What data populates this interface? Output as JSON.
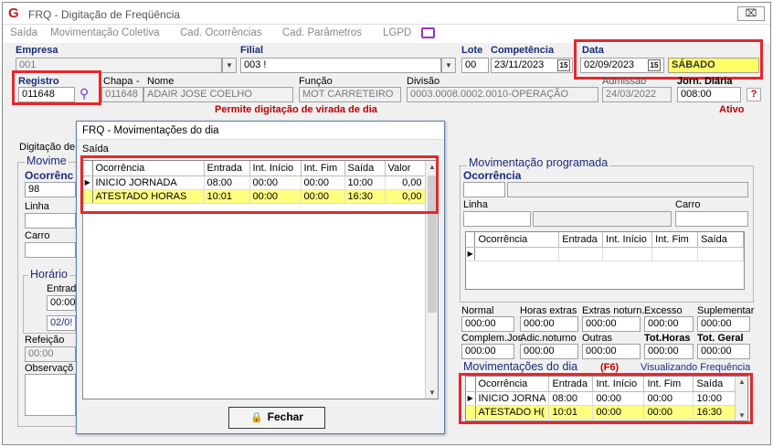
{
  "window": {
    "title": "FRQ - Digitação de Freqüência",
    "close": "⌧"
  },
  "menu": [
    "Saída",
    "Movimentação Coletiva",
    "Cad. Ocorrências",
    "Cad. Parâmetros",
    "LGPD"
  ],
  "header": {
    "empresa_label": "Empresa",
    "empresa_value": "001",
    "filial_label": "Filial",
    "filial_value": "003 !",
    "lote_label": "Lote",
    "lote_value": "00",
    "competencia_label": "Competência",
    "competencia_value": "23/11/2023",
    "data_label": "Data",
    "data_value": "02/09/2023",
    "dia_semana": "SÁBADO",
    "registro_label": "Registro",
    "registro_value": "011648",
    "chapa_label": "Chapa",
    "chapa_value": "011648",
    "nome_label": "Nome",
    "nome_value": "ADAIR JOSE COELHO",
    "funcao_label": "Função",
    "funcao_value": "MOT CARRETEIRO",
    "divisao_label": "Divisão",
    "divisao_value": "0003.0008.0002.0010-OPERAÇÃO",
    "admissao_label": "Admissão",
    "admissao_value": "24/03/2022",
    "jorn_label": "Jorn. Diária",
    "jorn_value": "008:00",
    "help": "?",
    "warning": "Permite digitação de virada de dia",
    "status": "Ativo",
    "cal_icon": "15"
  },
  "left_panel": {
    "tab": "Digitação de",
    "group_title": "Movime",
    "ocorrencia_label": "Ocorrênc",
    "ocorrencia_value": "98",
    "linha_label": "Linha",
    "carro_label": "Carro",
    "horario_title": "Horário",
    "entrada_label": "Entrad",
    "entrada_value": "00:00",
    "date_partial": "02/0!",
    "refeicao_label": "Refeição",
    "refeicao_value": "00:00",
    "obs_label": "Observaçõ"
  },
  "dialog": {
    "title": "FRQ - Movimentações do dia",
    "menu": "Saída",
    "columns": [
      "Ocorrência",
      "Entrada",
      "Int. Início",
      "Int. Fim",
      "Saída",
      "Valor"
    ],
    "rows": [
      {
        "ocorrencia": "INICIO JORNADA",
        "entrada": "08:00",
        "ini": "00:00",
        "fim": "00:00",
        "saida": "10:00",
        "valor": "0,00"
      },
      {
        "ocorrencia": "ATESTADO HORAS",
        "entrada": "10:01",
        "ini": "00:00",
        "fim": "00:00",
        "saida": "16:30",
        "valor": "0,00"
      }
    ],
    "button": "Fechar"
  },
  "right_panel": {
    "group_title": "Movimentação programada",
    "ocorrencia_label": "Ocorrência",
    "linha_label": "Linha",
    "carro_label": "Carro",
    "grid_columns": [
      "Ocorrência",
      "Entrada",
      "Int. Início",
      "Int. Fim",
      "Saída"
    ],
    "totals": {
      "normal_label": "Normal",
      "normal": "000:00",
      "horas_extras_label": "Horas extras",
      "horas_extras": "000:00",
      "extras_noturn_label": "Extras noturn.",
      "extras_noturn": "000:00",
      "excesso_label": "Excesso",
      "excesso": "000:00",
      "suplementar_label": "Suplementar",
      "suplementar": "000:00",
      "complem_label": "Complem.Jor.",
      "complem": "000:00",
      "adic_label": "Adic.noturno",
      "adic": "000:00",
      "outras_label": "Outras",
      "outras": "000:00",
      "tot_horas_label": "Tot.Horas",
      "tot_horas": "000:00",
      "tot_geral_label": "Tot. Geral",
      "tot_geral": "000:00"
    },
    "mov_dia_title": "Movimentações do dia",
    "mov_dia_key": "(F6)",
    "visualizando": "Visualizando Frequência",
    "mov_columns": [
      "Ocorrência",
      "Entrada",
      "Int. Início",
      "Int. Fim",
      "Saída"
    ],
    "mov_rows": [
      {
        "ocorrencia": "INICIO JORNA",
        "entrada": "08:00",
        "ini": "00:00",
        "fim": "00:00",
        "saida": "10:00"
      },
      {
        "ocorrencia": "ATESTADO H(",
        "entrada": "10:01",
        "ini": "00:00",
        "fim": "00:00",
        "saida": "16:30"
      }
    ]
  }
}
